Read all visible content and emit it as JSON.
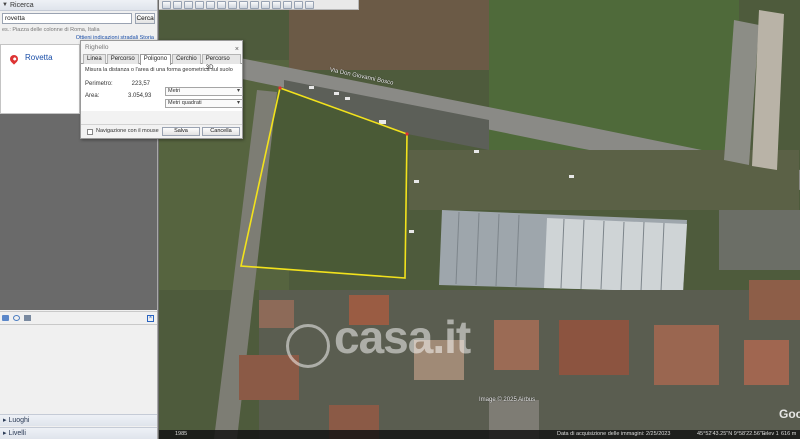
{
  "search": {
    "section_title": "Ricerca",
    "query": "rovetta",
    "button_label": "Cerca",
    "hint": "es.: Piazza delle colonne di Roma, Italia",
    "links": "Ottieni indicazioni stradali  Storia"
  },
  "result": {
    "title": "Rovetta"
  },
  "places": {
    "luoghi_label": "Luoghi",
    "livelli_label": "Livelli"
  },
  "map": {
    "road_label": "Via Don Giovanni Bosco",
    "watermark": "casa.it",
    "copyright": "Image © 2025 Airbus",
    "google_logo": "Google"
  },
  "status": {
    "year": "1985",
    "imagery_date": "Data di acquisizione delle immagini: 2/25/2023",
    "coords": "45°52'43.25\"N   9°58'22.56\"E",
    "altitude": "elev  1",
    "eye": "616 m"
  },
  "ruler": {
    "title": "Righello",
    "close": "×",
    "tabs": [
      "Linea",
      "Percorso",
      "Poligono",
      "Cerchio",
      "Percorso 3D"
    ],
    "active_tab": "Poligono",
    "description": "Misura la distanza o l'area di una forma geometrica sul suolo",
    "perimeter_label": "Perimetro:",
    "perimeter_value": "223,57",
    "perimeter_unit": "Metri",
    "area_label": "Area:",
    "area_value": "3.054,93",
    "area_unit": "Metri quadrati",
    "nav_label": "Navigazione con il mouse",
    "save_label": "Salva",
    "cancel_label": "Cancella"
  },
  "colors": {
    "polygon": "#f2e21c",
    "link": "#1a4ea8"
  }
}
